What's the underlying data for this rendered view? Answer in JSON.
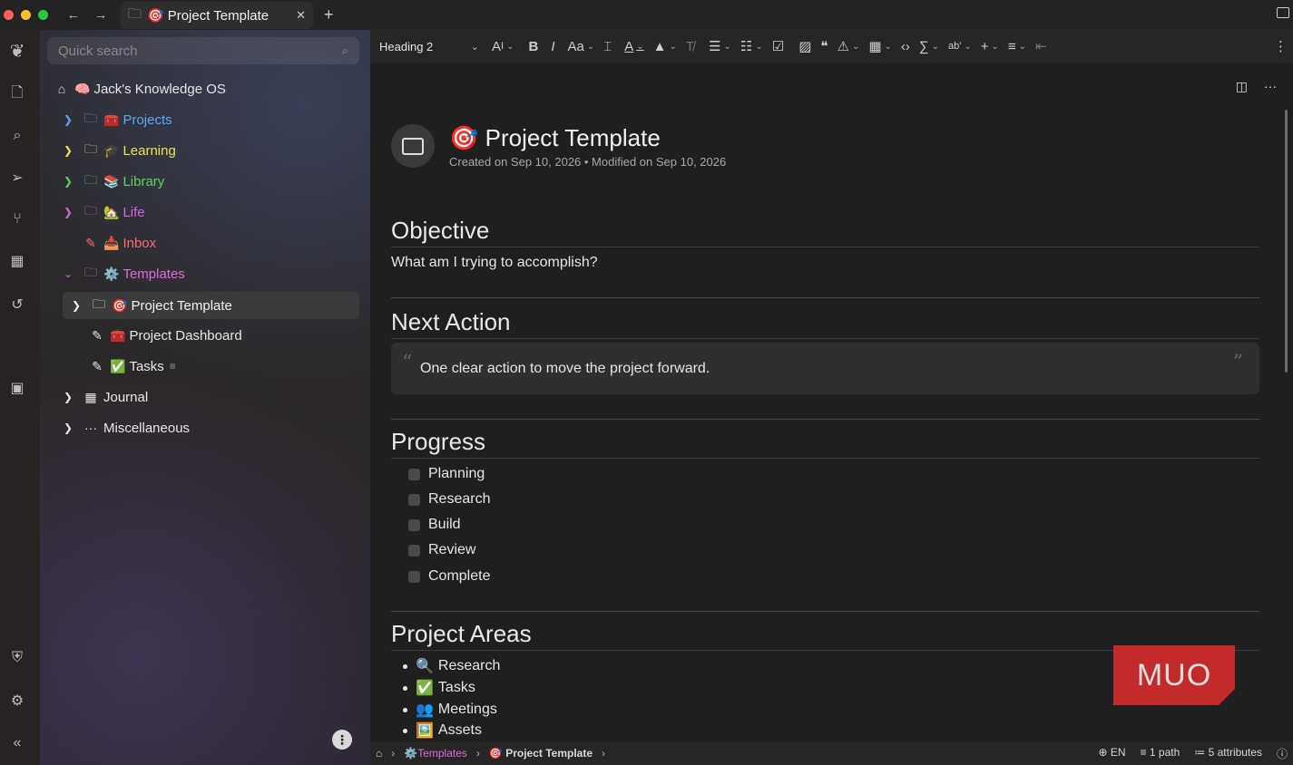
{
  "window": {
    "traffic_colors": [
      "#ff5f57",
      "#febc2e",
      "#28c840"
    ],
    "tab": {
      "emoji": "🎯",
      "title": "Project Template"
    }
  },
  "sidebar": {
    "search_placeholder": "Quick search",
    "root": {
      "emoji": "🧠",
      "label": "Jack's Knowledge OS"
    },
    "items": [
      {
        "emoji": "🧰",
        "label": "Projects",
        "color": "#5aa9ff",
        "expanded": false,
        "type": "folder"
      },
      {
        "emoji": "🎓",
        "label": "Learning",
        "color": "#f0e24a",
        "expanded": false,
        "type": "folder"
      },
      {
        "emoji": "📚",
        "label": "Library",
        "color": "#5fd35f",
        "expanded": false,
        "type": "folder"
      },
      {
        "emoji": "🏡",
        "label": "Life",
        "color": "#d864e8",
        "expanded": false,
        "type": "folder"
      },
      {
        "emoji": "📥",
        "label": "Inbox",
        "color": "#ff6b6b",
        "type": "note"
      },
      {
        "emoji": "⚙️",
        "label": "Templates",
        "color": "#e06ad8",
        "expanded": true,
        "type": "folder"
      }
    ],
    "template_children": [
      {
        "emoji": "🎯",
        "label": "Project Template",
        "selected": true,
        "type": "folder"
      },
      {
        "emoji": "🧰",
        "label": "Project Dashboard",
        "type": "note"
      },
      {
        "emoji": "✅",
        "label": "Tasks",
        "type": "note"
      }
    ],
    "bottom_items": [
      {
        "icon": "📅",
        "label": "Journal"
      },
      {
        "icon": "···",
        "label": "Miscellaneous"
      }
    ]
  },
  "toolbar": {
    "heading_select": "Heading 2"
  },
  "note": {
    "title_emoji": "🎯",
    "title": "Project Template",
    "meta": "Created on Sep 10, 2026 • Modified on Sep 10, 2026",
    "sections": {
      "objective": {
        "heading": "Objective",
        "text": "What am I trying to accomplish?"
      },
      "next_action": {
        "heading": "Next Action",
        "quote": "One clear action to move the project forward."
      },
      "progress": {
        "heading": "Progress",
        "items": [
          "Planning",
          "Research",
          "Build",
          "Review",
          "Complete"
        ]
      },
      "areas": {
        "heading": "Project Areas",
        "items": [
          {
            "emoji": "🔍",
            "label": "Research"
          },
          {
            "emoji": "✅",
            "label": "Tasks"
          },
          {
            "emoji": "👥",
            "label": "Meetings"
          },
          {
            "emoji": "🖼️",
            "label": "Assets"
          }
        ]
      }
    }
  },
  "statusbar": {
    "crumb_1": "Templates",
    "crumb_1_emoji": "⚙️",
    "crumb_2": "Project Template",
    "crumb_2_emoji": "🎯",
    "language": "EN",
    "paths": "1 path",
    "attributes": "5 attributes"
  },
  "watermark": "MUO"
}
